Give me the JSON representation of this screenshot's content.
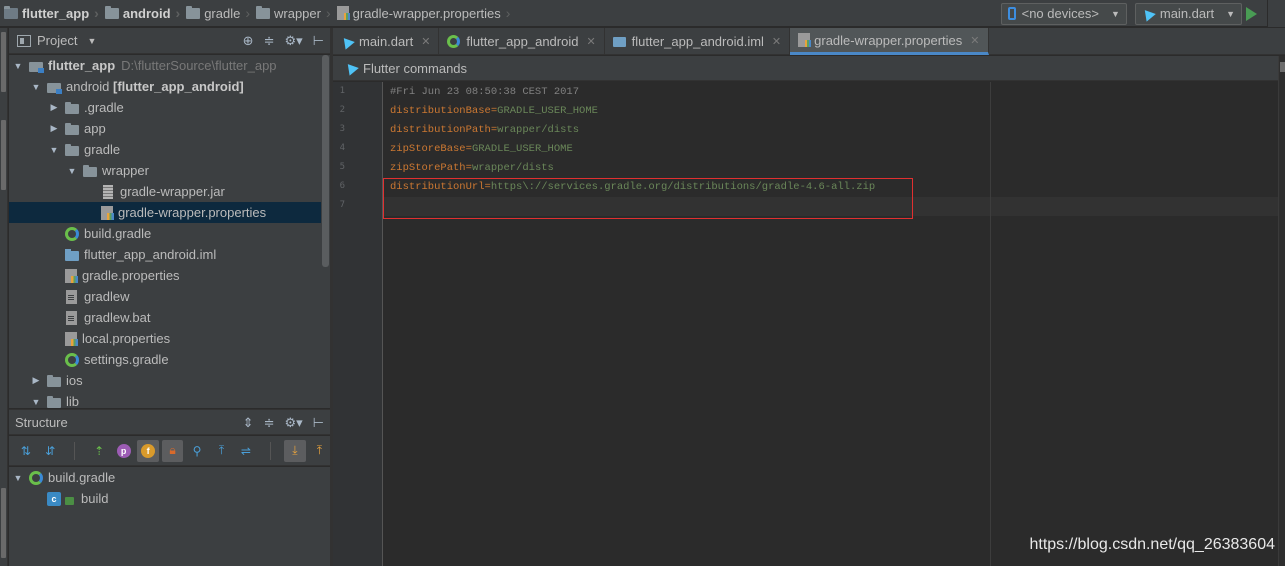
{
  "breadcrumb": [
    "flutter_app",
    "android",
    "gradle",
    "wrapper",
    "gradle-wrapper.properties"
  ],
  "toolbar": {
    "device_selector": "<no devices>",
    "run_config": "main.dart"
  },
  "project_panel": {
    "title": "Project",
    "tree": [
      {
        "label": "flutter_app",
        "path": "D:\\flutterSource\\flutter_app"
      },
      {
        "label": "android",
        "module": "[flutter_app_android]"
      },
      {
        "label": ".gradle"
      },
      {
        "label": "app"
      },
      {
        "label": "gradle"
      },
      {
        "label": "wrapper"
      },
      {
        "label": "gradle-wrapper.jar"
      },
      {
        "label": "gradle-wrapper.properties"
      },
      {
        "label": "build.gradle"
      },
      {
        "label": "flutter_app_android.iml"
      },
      {
        "label": "gradle.properties"
      },
      {
        "label": "gradlew"
      },
      {
        "label": "gradlew.bat"
      },
      {
        "label": "local.properties"
      },
      {
        "label": "settings.gradle"
      },
      {
        "label": "ios"
      },
      {
        "label": "lib"
      }
    ]
  },
  "structure_panel": {
    "title": "Structure",
    "tree": [
      {
        "label": "build.gradle"
      },
      {
        "label": "build"
      }
    ]
  },
  "tabs": [
    {
      "label": "main.dart"
    },
    {
      "label": "flutter_app_android"
    },
    {
      "label": "flutter_app_android.iml"
    },
    {
      "label": "gradle-wrapper.properties"
    }
  ],
  "flutter_commands": "Flutter commands",
  "editor": {
    "line_numbers": [
      "1",
      "2",
      "3",
      "4",
      "5",
      "6",
      "7"
    ],
    "lines": [
      {
        "comment": "#Fri Jun 23 08:50:38 CEST 2017"
      },
      {
        "key": "distributionBase",
        "value": "GRADLE_USER_HOME"
      },
      {
        "key": "distributionPath",
        "value": "wrapper/dists"
      },
      {
        "key": "zipStoreBase",
        "value": "GRADLE_USER_HOME"
      },
      {
        "key": "zipStorePath",
        "value": "wrapper/dists"
      },
      {
        "key": "distributionUrl",
        "value": "https\\://services.gradle.org/distributions/gradle-4.6-all.zip"
      },
      {
        "key": "",
        "value": ""
      }
    ]
  },
  "watermark": "https://blog.csdn.net/qq_26383604",
  "colors": {
    "keyword": "#cc7832",
    "value": "#6a8759",
    "selection": "#0d293e",
    "highlight_box": "#e03030",
    "accent": "#4a88c7"
  }
}
